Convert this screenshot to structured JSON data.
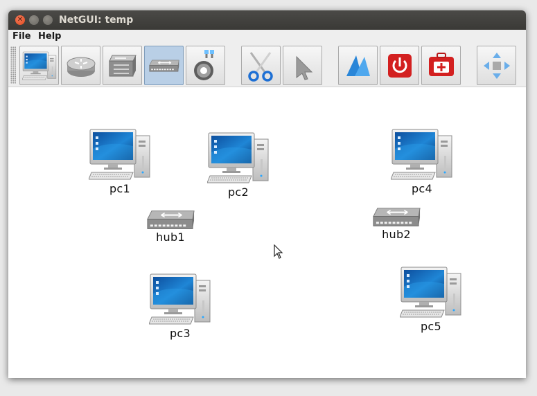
{
  "window": {
    "title": "NetGUI: temp"
  },
  "menu": [
    "File",
    "Help"
  ],
  "toolbar": {
    "buttons": [
      {
        "name": "terminal-tool-button",
        "icon": "computer-icon",
        "active": false
      },
      {
        "name": "router-tool-button",
        "icon": "router-icon",
        "active": false
      },
      {
        "name": "switch-tool-button",
        "icon": "switch-icon",
        "active": false
      },
      {
        "name": "hub-tool-button",
        "icon": "hub-icon",
        "active": true
      },
      {
        "name": "link-tool-button",
        "icon": "cable-icon",
        "active": false
      },
      {
        "name": "cut-tool-button",
        "icon": "scissors-icon",
        "active": false
      },
      {
        "name": "select-tool-button",
        "icon": "pointer-icon",
        "active": false
      },
      {
        "name": "start-tool-button",
        "icon": "start-icon",
        "active": false
      },
      {
        "name": "power-off-button",
        "icon": "power-icon",
        "active": false
      },
      {
        "name": "first-aid-button",
        "icon": "first-aid-icon",
        "active": false
      },
      {
        "name": "move-tool-button",
        "icon": "move-icon",
        "active": false
      }
    ]
  },
  "nodes": {
    "pc1": "pc1",
    "pc2": "pc2",
    "pc3": "pc3",
    "pc4": "pc4",
    "pc5": "pc5",
    "hub1": "hub1",
    "hub2": "hub2"
  },
  "colors": {
    "titlebar": "#3c3b37",
    "active_tool": "#b9cfe6",
    "canvas": "#ffffff",
    "power_button": "#d32020"
  }
}
